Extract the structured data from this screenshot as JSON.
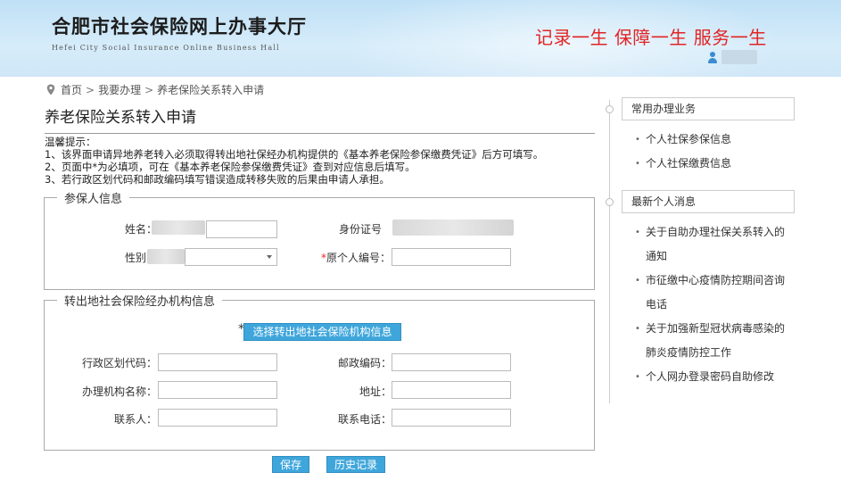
{
  "header": {
    "title": "合肥市社会保险网上办事大厅",
    "subtitle": "Hefei City Social Insurance Online Business Hall",
    "slogan": "记录一生 保障一生 服务一生",
    "user_icon": "user-icon"
  },
  "breadcrumb": {
    "home": "首页",
    "separator": ">",
    "level2": "我要办理",
    "current": "养老保险关系转入申请"
  },
  "page": {
    "title": "养老保险关系转入申请"
  },
  "notice": {
    "heading": "温馨提示：",
    "lines": [
      "1、该界面申请异地养老转入必须取得转出地社保经办机构提供的《基本养老保险参保缴费凭证》后方可填写。",
      "2、页面中*为必填项，可在《基本养老保险参保缴费凭证》查到对应信息后填写。",
      "3、若行政区划代码和邮政编码填写错误造成转移失败的后果由申请人承担。"
    ]
  },
  "insured": {
    "legend": "参保人信息",
    "name_label": "姓名：",
    "id_label": "身份证号",
    "gender_label": "性别",
    "orig_no_required": "*",
    "orig_no_label": "原个人编号：",
    "orig_no_value": ""
  },
  "transfer_org": {
    "legend": "转出地社会保险经办机构信息",
    "select_required": "*",
    "select_button": "选择转出地社会保险机构信息",
    "region_code_label": "行政区划代码：",
    "postcode_label": "邮政编码：",
    "org_name_label": "办理机构名称：",
    "address_label": "地址：",
    "contact_label": "联系人：",
    "phone_label": "联系电话：",
    "region_code_value": "",
    "postcode_value": "",
    "org_name_value": "",
    "address_value": "",
    "contact_value": "",
    "phone_value": ""
  },
  "actions": {
    "save": "保存",
    "history": "历史记录"
  },
  "sidebar": {
    "common_title": "常用办理业务",
    "common_items": [
      "个人社保参保信息",
      "个人社保缴费信息"
    ],
    "news_title": "最新个人消息",
    "news_items": [
      "关于自助办理社保关系转入的通知",
      "市征缴中心疫情防控期间咨询电话",
      "关于加强新型冠状病毒感染的肺炎疫情防控工作",
      "个人网办登录密码自助修改"
    ]
  },
  "colors": {
    "header_bg": "#cfe7f8",
    "slogan": "#e12424",
    "button": "#3fa6db",
    "required": "#ee2222"
  }
}
